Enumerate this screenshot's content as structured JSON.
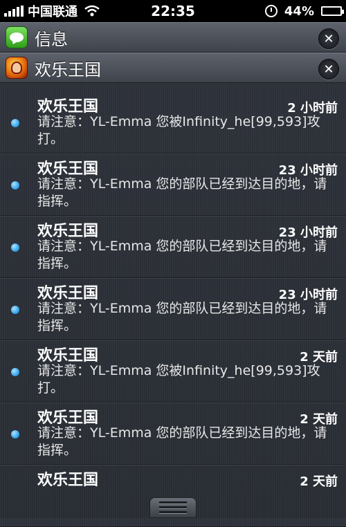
{
  "status_bar": {
    "carrier": "中国联通",
    "time": "22:35",
    "battery": "44%",
    "battery_level": 0.44
  },
  "sections": {
    "messages": {
      "title": "信息",
      "close": "✕"
    },
    "game": {
      "title": "欢乐王国",
      "close": "✕"
    }
  },
  "notifications": [
    {
      "app": "欢乐王国",
      "when": "2 小时前",
      "body": "请注意：YL-Emma 您被Infinity_he[99,593]攻打。"
    },
    {
      "app": "欢乐王国",
      "when": "23 小时前",
      "body": "请注意：YL-Emma 您的部队已经到达目的地，请指挥。"
    },
    {
      "app": "欢乐王国",
      "when": "23 小时前",
      "body": "请注意：YL-Emma 您的部队已经到达目的地，请指挥。"
    },
    {
      "app": "欢乐王国",
      "when": "23 小时前",
      "body": "请注意：YL-Emma 您的部队已经到达目的地，请指挥。"
    },
    {
      "app": "欢乐王国",
      "when": "2 天前",
      "body": "请注意：YL-Emma 您被Infinity_he[99,593]攻打。"
    },
    {
      "app": "欢乐王国",
      "when": "2 天前",
      "body": "请注意：YL-Emma 您的部队已经到达目的地，请指挥。"
    },
    {
      "app": "欢乐王国",
      "when": "2 天前",
      "body": ""
    }
  ],
  "colors": {
    "unread_dot": "#2a9be6",
    "background": "#2c3037"
  }
}
